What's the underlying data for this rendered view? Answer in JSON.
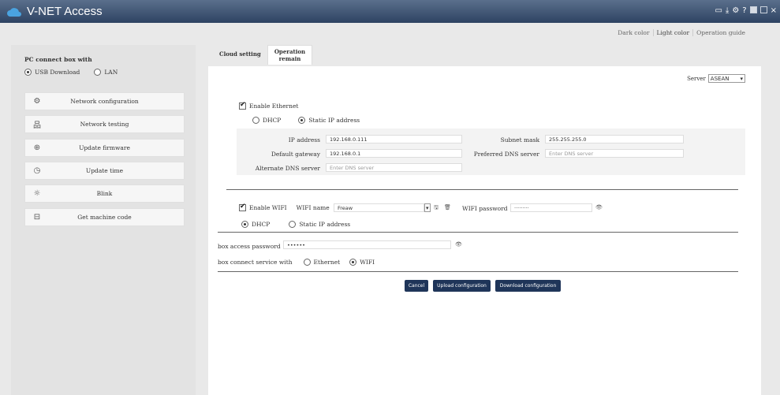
{
  "app": {
    "title": "V-NET Access",
    "accent": "#1f3559",
    "titlebar_color": "#3b5273"
  },
  "window_icons": [
    "monitor-icon",
    "download-icon",
    "gear-icon",
    "help-icon",
    "minimize-icon",
    "maximize-icon",
    "close-icon"
  ],
  "top_links": {
    "dark": "Dark color",
    "light": "Light color",
    "guide": "Operation guide"
  },
  "tabs": [
    {
      "label": "Cloud setting"
    },
    {
      "label_line1": "Operation",
      "label_line2": "remain"
    }
  ],
  "left": {
    "connect_label": "PC connect box with",
    "options": [
      {
        "label": "USB Download",
        "selected": true
      },
      {
        "label": "LAN",
        "selected": false
      }
    ],
    "menu": [
      {
        "icon": "settings-icon",
        "label": "Network configuration"
      },
      {
        "icon": "network-icon",
        "label": "Network testing"
      },
      {
        "icon": "upload-icon",
        "label": "Update firmware"
      },
      {
        "icon": "clock-icon",
        "label": "Update time"
      },
      {
        "icon": "sun-icon",
        "label": "Blink"
      },
      {
        "icon": "device-icon",
        "label": "Get machine code"
      }
    ]
  },
  "server": {
    "label": "Server",
    "value": "ASEAN"
  },
  "ethernet": {
    "enable_label": "Enable Ethernet",
    "enabled": true,
    "dhcp": "DHCP",
    "static": "Static IP address",
    "mode": "static",
    "ip_label": "IP address",
    "ip": "192.168.0.111",
    "mask_label": "Subnet mask",
    "mask": "255.255.255.0",
    "gateway_label": "Default gateway",
    "gateway": "192.168.0.1",
    "dns_label": "Preferred DNS server",
    "dns_placeholder": "Enter DNS server",
    "alt_dns_label": "Alternate DNS server",
    "alt_dns_placeholder": "Enter DNS server"
  },
  "wifi": {
    "enable_label": "Enable WIFI",
    "enabled": true,
    "name_label": "WIFI name",
    "name": "Freaw",
    "password_label": "WIFI password",
    "password": "·········",
    "dhcp": "DHCP",
    "static": "Static IP address",
    "mode": "dhcp"
  },
  "box": {
    "password_label": "box access password",
    "password": "••••••",
    "service_label": "box connect service with",
    "eth": "Ethernet",
    "wifi": "WIFI",
    "selected": "wifi"
  },
  "buttons": {
    "cancel": "Cancel",
    "upload": "Upload configuration",
    "download": "Download configuration"
  }
}
